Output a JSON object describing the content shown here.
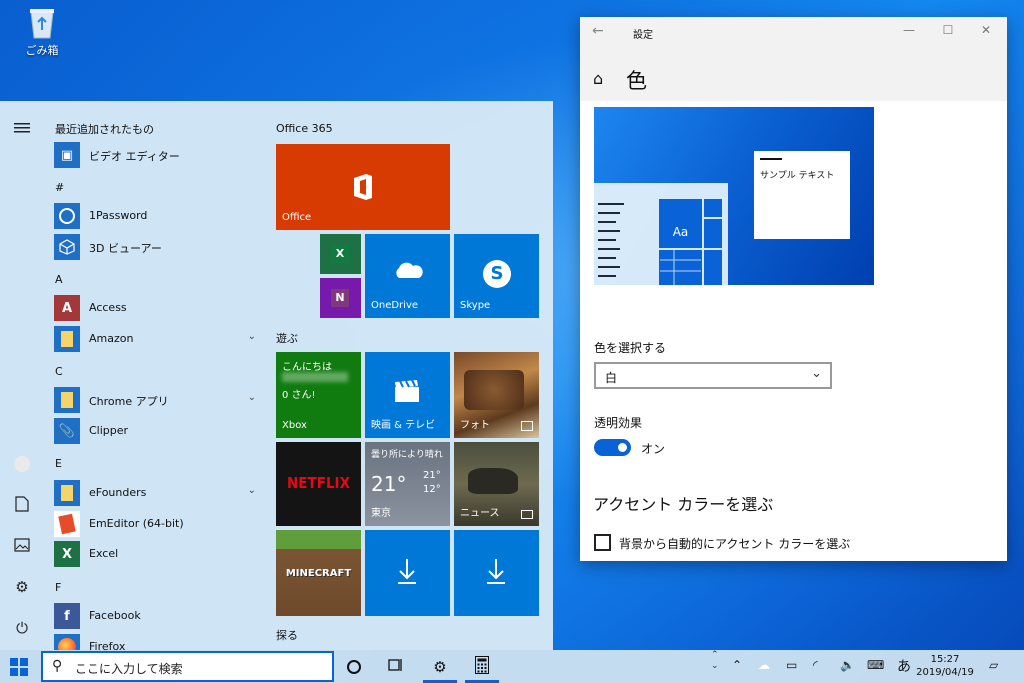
{
  "desktop": {
    "recycle_bin_label": "ごみ箱"
  },
  "start_menu": {
    "recent_header": "最近追加されたもの",
    "apps": [
      {
        "name": "ビデオ エディター",
        "color": "#1f6fc5",
        "icon": "film-icon"
      },
      {
        "letter": "#"
      },
      {
        "name": "1Password",
        "color": "#1f6fc5",
        "icon": "key-icon"
      },
      {
        "name": "3D ビューアー",
        "color": "#1f6fc5",
        "icon": "cube-icon"
      },
      {
        "letter": "A"
      },
      {
        "name": "Access",
        "color": "#a4373a",
        "icon": "access-icon"
      },
      {
        "name": "Amazon",
        "color": "#1f6fc5",
        "icon": "folder-icon",
        "expandable": true
      },
      {
        "letter": "C"
      },
      {
        "name": "Chrome アプリ",
        "color": "#1f6fc5",
        "icon": "folder-icon",
        "expandable": true
      },
      {
        "name": "Clipper",
        "color": "#1f6fc5",
        "icon": "clip-icon"
      },
      {
        "letter": "E"
      },
      {
        "name": "eFounders",
        "color": "#1f6fc5",
        "icon": "folder-icon",
        "expandable": true
      },
      {
        "name": "EmEditor (64-bit)",
        "color": "#ffffff",
        "icon": "emeditor-icon"
      },
      {
        "name": "Excel",
        "color": "#1e7145",
        "icon": "excel-icon"
      },
      {
        "letter": "F"
      },
      {
        "name": "Facebook",
        "color": "#1f6fc5",
        "icon": "facebook-icon"
      },
      {
        "name": "Firefox",
        "color": "#1f6fc5",
        "icon": "firefox-icon"
      }
    ],
    "tile_groups": {
      "office_title": "Office 365",
      "play_title": "遊ぶ",
      "explore_title": "探る"
    },
    "tiles": {
      "office": "Office",
      "onedrive": "OneDrive",
      "skype": "Skype",
      "xbox_greeting": "こんにちは",
      "xbox_user": "0 さん!",
      "xbox": "Xbox",
      "movies": "映画 & テレビ",
      "photos": "フォト",
      "netflix": "NETFLIX",
      "weather_cond": "曇り所により晴れ",
      "weather_temp": "21°",
      "weather_high": "21°",
      "weather_low": "12°",
      "weather_city": "東京",
      "news": "ニュース",
      "minecraft": "MINECRAFT"
    }
  },
  "settings": {
    "window_title": "設定",
    "page_title": "色",
    "preview_sample_text": "サンプル テキスト",
    "preview_tile_text": "Aa",
    "color_select_label": "色を選択する",
    "color_select_value": "白",
    "transparency_label": "透明効果",
    "transparency_state": "オン",
    "accent_heading": "アクセント カラーを選ぶ",
    "accent_auto_label": "背景から自動的にアクセント カラーを選ぶ"
  },
  "taskbar": {
    "search_placeholder": "ここに入力して検索",
    "ime": "あ",
    "time": "15:27",
    "date": "2019/04/19"
  },
  "colors": {
    "accent": "#0a63d6",
    "office_tile": "#d83b01",
    "tile_blue": "#0078d7",
    "xbox_tile": "#107c10"
  }
}
